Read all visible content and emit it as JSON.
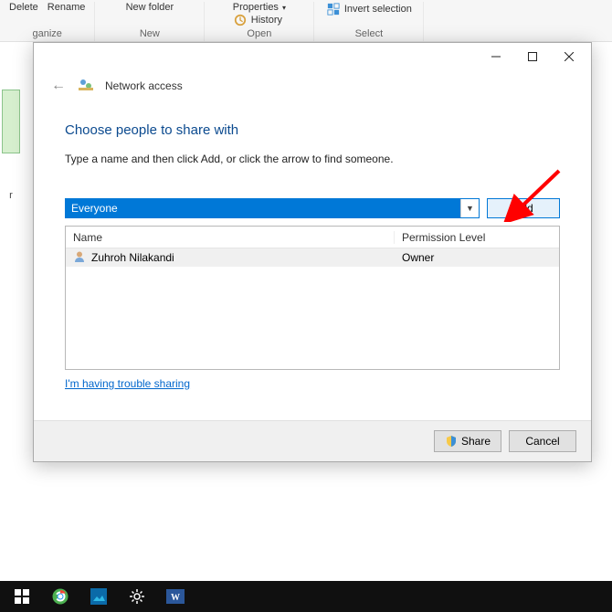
{
  "ribbon": {
    "organize": {
      "label": "ganize",
      "items": [
        "Delete",
        "Rename"
      ]
    },
    "new": {
      "label": "New",
      "items": [
        "New folder"
      ]
    },
    "open": {
      "label": "Open",
      "items": [
        "Properties",
        "History"
      ]
    },
    "select": {
      "label": "Select",
      "items": [
        "Invert selection"
      ]
    }
  },
  "dialog": {
    "title": "Network access",
    "heading": "Choose people to share with",
    "subtext": "Type a name and then click Add, or click the arrow to find someone.",
    "comboValue": "Everyone",
    "addLabel": "Add",
    "columns": {
      "name": "Name",
      "perm": "Permission Level"
    },
    "rows": [
      {
        "name": "Zuhroh Nilakandi",
        "perm": "Owner"
      }
    ],
    "troubleLink": "I'm having trouble sharing",
    "shareLabel": "Share",
    "cancelLabel": "Cancel"
  },
  "leftHint": {
    "label": "r"
  }
}
